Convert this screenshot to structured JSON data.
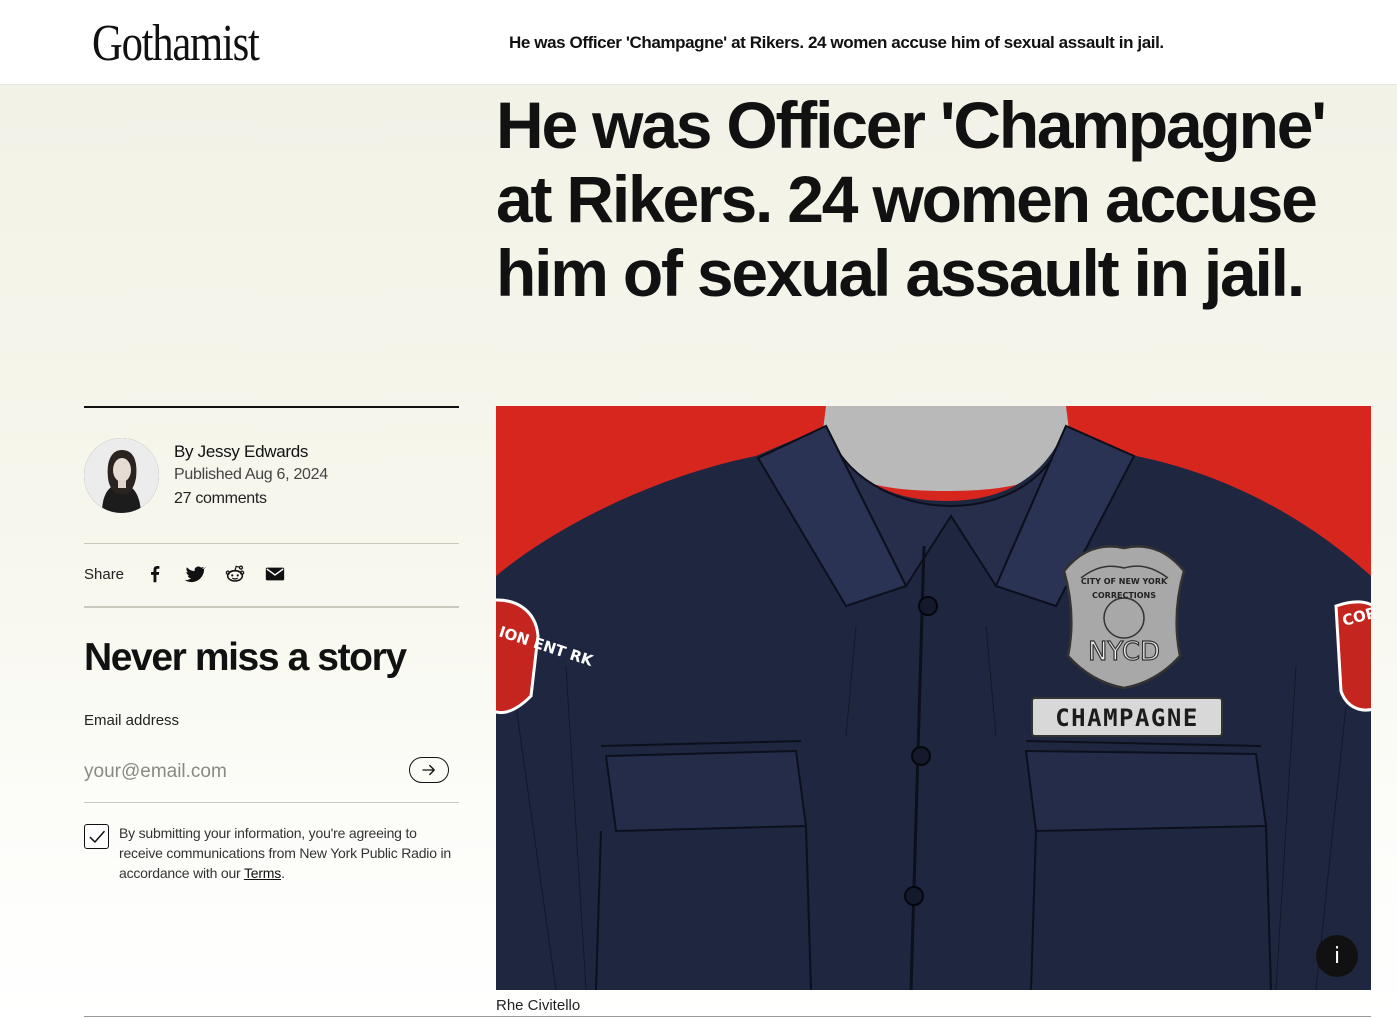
{
  "header": {
    "logo": "Gothamist",
    "sticky_headline": "He was Officer 'Champagne' at Rikers. 24 women accuse him of sexual assault in jail."
  },
  "article": {
    "headline": "He was Officer 'Champagne' at Rikers. 24 women accuse him of sexual assault in jail.",
    "author": "By Jessy Edwards",
    "published": "Published Aug 6, 2024",
    "comments": "27 comments"
  },
  "share": {
    "label": "Share",
    "icons": [
      "facebook-icon",
      "twitter-icon",
      "reddit-icon",
      "email-icon"
    ]
  },
  "newsletter": {
    "title": "Never miss a story",
    "email_label": "Email address",
    "email_placeholder": "your@email.com",
    "email_value": "",
    "checkbox_checked": true,
    "consent_text": "By submitting your information, you're agreeing to receive communications from New York Public Radio in accordance with our",
    "terms_link": "Terms",
    "consent_end": "."
  },
  "hero": {
    "nametag": "CHAMPAGNE",
    "badge_top": "CITY OF NEW YORK",
    "badge_mid": "CORRECTIONS",
    "badge_bottom": "NYCD",
    "patch_left": "ION ENT RK",
    "patch_right": "COR DEF",
    "info_button": "i",
    "credit": "Rhe Civitello"
  },
  "colors": {
    "accent_bg": "#f3f2e7",
    "hero_red": "#d6261e",
    "uniform_navy": "#1f2640",
    "text": "#111111"
  }
}
